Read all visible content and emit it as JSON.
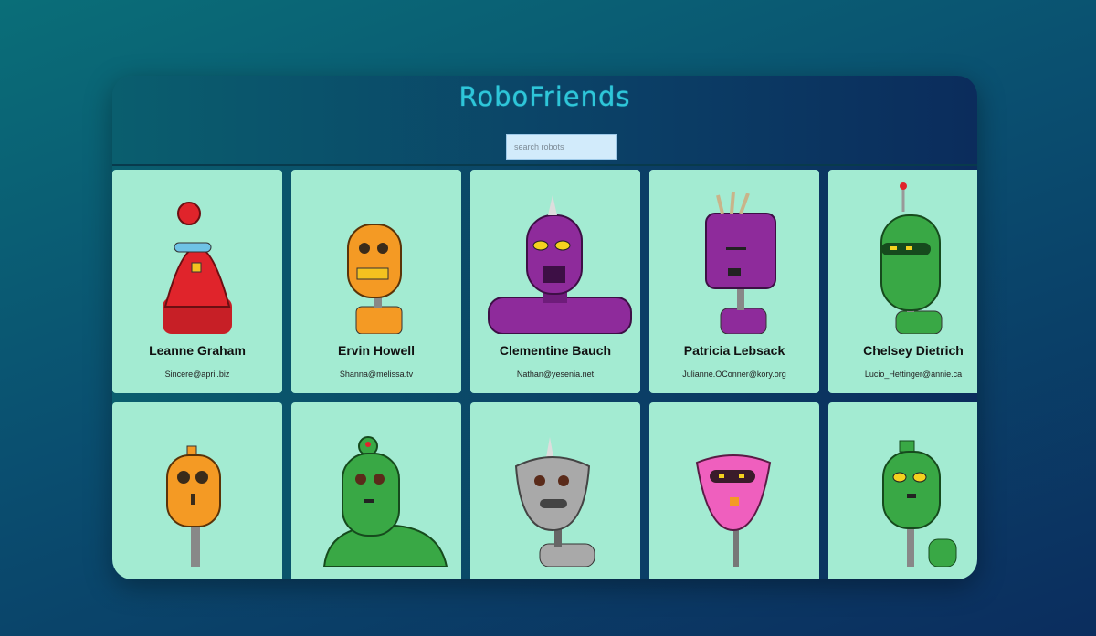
{
  "app": {
    "title": "RoboFriends"
  },
  "search": {
    "placeholder": "search robots",
    "value": ""
  },
  "robots": [
    {
      "name": "Leanne Graham",
      "email": "Sincere@april.biz",
      "color": "#e0242b"
    },
    {
      "name": "Ervin Howell",
      "email": "Shanna@melissa.tv",
      "color": "#f49a24"
    },
    {
      "name": "Clementine Bauch",
      "email": "Nathan@yesenia.net",
      "color": "#8e2b9b"
    },
    {
      "name": "Patricia Lebsack",
      "email": "Julianne.OConner@kory.org",
      "color": "#8e2b9b"
    },
    {
      "name": "Chelsey Dietrich",
      "email": "Lucio_Hettinger@annie.ca",
      "color": "#39a845"
    },
    {
      "name": "",
      "email": "",
      "color": "#f49a24"
    },
    {
      "name": "",
      "email": "",
      "color": "#39a845"
    },
    {
      "name": "",
      "email": "",
      "color": "#a9a9a9"
    },
    {
      "name": "",
      "email": "",
      "color": "#ef5fbe"
    },
    {
      "name": "",
      "email": "",
      "color": "#39a845"
    }
  ]
}
